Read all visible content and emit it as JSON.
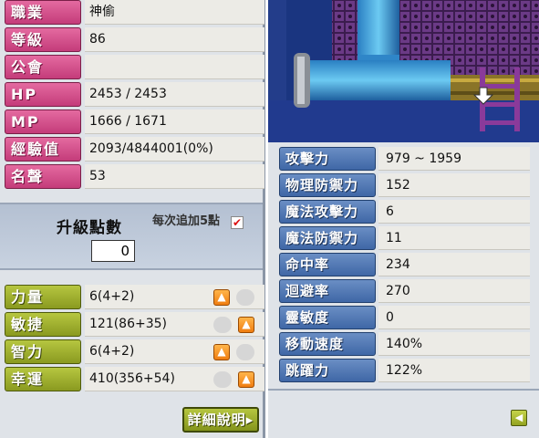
{
  "profile": {
    "rows": [
      {
        "label": "職業",
        "value": "神偷"
      },
      {
        "label": "等級",
        "value": "86"
      },
      {
        "label": "公會",
        "value": ""
      },
      {
        "label": "HP",
        "value": "2453 / 2453"
      },
      {
        "label": "MP",
        "value": "1666 / 1671"
      },
      {
        "label": "經驗值",
        "value": "2093/4844001(0%)"
      },
      {
        "label": "名聲",
        "value": "53"
      }
    ]
  },
  "ability_points": {
    "title": "升級點數",
    "value": "0",
    "note": "每次追加5點",
    "checkbox_mark": "✔"
  },
  "base_stats": [
    {
      "label": "力量",
      "value": "6(4+2)",
      "up_icon": "up-arrow-icon"
    },
    {
      "label": "敏捷",
      "value": "121(86+35)",
      "up_icon": "up-arrow-icon"
    },
    {
      "label": "智力",
      "value": "6(4+2)",
      "up_icon": "up-arrow-icon"
    },
    {
      "label": "幸運",
      "value": "410(356+54)",
      "up_icon": "up-arrow-icon"
    }
  ],
  "detail_button": {
    "label": "詳細說明▸"
  },
  "detail_stats": [
    {
      "label": "攻擊力",
      "value": "979 ~ 1959"
    },
    {
      "label": "物理防禦力",
      "value": "152"
    },
    {
      "label": "魔法攻擊力",
      "value": "6"
    },
    {
      "label": "魔法防禦力",
      "value": "11"
    },
    {
      "label": "命中率",
      "value": "234"
    },
    {
      "label": "迴避率",
      "value": "270"
    },
    {
      "label": "靈敏度",
      "value": "0"
    },
    {
      "label": "移動速度",
      "value": "140%"
    },
    {
      "label": "跳躍力",
      "value": "122%"
    }
  ],
  "collapse_button": {
    "icon": "arrow-left-icon",
    "glyph": "◀"
  },
  "up_glyph": "▲",
  "colors": {
    "pink_label": "#d4508c",
    "green_label": "#9aae2c",
    "blue_label": "#4f76b4",
    "up_button": "#f58a1e",
    "panel_bg": "#dfe3e8"
  }
}
